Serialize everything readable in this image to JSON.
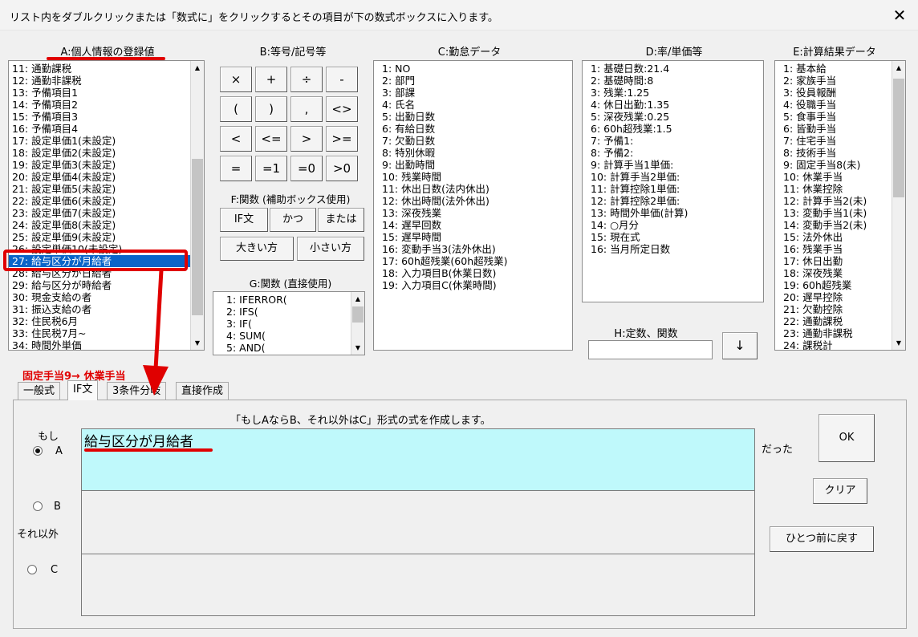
{
  "window": {
    "title": "リスト内をダブルクリックまたは「数式に」をクリックするとその項目が下の数式ボックスに入ります。",
    "close_glyph": "✕"
  },
  "panels": {
    "a": {
      "label": "A:個人情報の登録値",
      "items": [
        "11: 通勤課税",
        "12: 通勤非課税",
        "13: 予備項目1",
        "14: 予備項目2",
        "15: 予備項目3",
        "16: 予備項目4",
        "17: 設定単価1(未設定)",
        "18: 設定単価2(未設定)",
        "19: 設定単価3(未設定)",
        "20: 設定単価4(未設定)",
        "21: 設定単価5(未設定)",
        "22: 設定単価6(未設定)",
        "23: 設定単価7(未設定)",
        "24: 設定単価8(未設定)",
        "25: 設定単価9(未設定)",
        "26: 設定単価10(未設定)",
        "27: 給与区分が月給者",
        "28: 給与区分が日給者",
        "29: 給与区分が時給者",
        "30: 現金支給の者",
        "31: 振込支給の者",
        "32: 住民税6月",
        "33: 住民税7月~",
        "34: 時間外単価"
      ],
      "selected_index": 16
    },
    "b": {
      "label": "B:等号/記号等",
      "buttons": [
        "×",
        "+",
        "÷",
        "-",
        "(",
        ")",
        ",",
        "<>",
        "<",
        "<=",
        ">",
        ">=",
        "=",
        "=1",
        "=0",
        ">0"
      ]
    },
    "f": {
      "label": "F:関数 (補助ボックス使用)",
      "buttons": [
        "IF文",
        "かつ",
        "または",
        "大きい方",
        "小さい方"
      ]
    },
    "g": {
      "label": "G:関数 (直接使用)",
      "items": [
        "1: IFERROR(",
        "2: IFS(",
        "3: IF(",
        "4: SUM(",
        "5: AND("
      ]
    },
    "c": {
      "label": "C:勤怠データ",
      "items": [
        "1: NO",
        "2: 部門",
        "3: 部課",
        "4: 氏名",
        "5: 出勤日数",
        "6: 有給日数",
        "7: 欠勤日数",
        "8: 特別休暇",
        "9: 出勤時間",
        "10: 残業時間",
        "11: 休出日数(法内休出)",
        "12: 休出時間(法外休出)",
        "13: 深夜残業",
        "14: 遅早回数",
        "15: 遅早時間",
        "16: 変動手当3(法外休出)",
        "17: 60h超残業(60h超残業)",
        "18: 入力項目B(休業日数)",
        "19: 入力項目C(休業時間)"
      ]
    },
    "d": {
      "label": "D:率/単価等",
      "items": [
        "1: 基礎日数:21.4",
        "2: 基礎時間:8",
        "3: 残業:1.25",
        "4: 休日出勤:1.35",
        "5: 深夜残業:0.25",
        "6: 60h超残業:1.5",
        "7: 予備1:",
        "8: 予備2:",
        "9: 計算手当1単価:",
        "10: 計算手当2単価:",
        "11: 計算控除1単価:",
        "12: 計算控除2単価:",
        "13: 時間外単価(計算)",
        "14: ○月分",
        "15: 現在式",
        "16: 当月所定日数"
      ]
    },
    "h": {
      "label": "H:定数、関数",
      "input_value": "",
      "down_button": "↓"
    },
    "e": {
      "label": "E:計算結果データ",
      "items": [
        "1: 基本給",
        "2: 家族手当",
        "3: 役員報酬",
        "4: 役職手当",
        "5: 食事手当",
        "6: 皆勤手当",
        "7: 住宅手当",
        "8: 技術手当",
        "9: 固定手当8(未)",
        "10: 休業手当",
        "11: 休業控除",
        "12: 計算手当2(未)",
        "13: 変動手当1(未)",
        "14: 変動手当2(未)",
        "15: 法外休出",
        "16: 残業手当",
        "17: 休日出勤",
        "18: 深夜残業",
        "19: 60h超残業",
        "20: 遅早控除",
        "21: 欠勤控除",
        "22: 通勤課税",
        "23: 通勤非課税",
        "24: 課税計"
      ]
    }
  },
  "annotation": {
    "text": "固定手当9→ 休業手当",
    "color": "#e00000"
  },
  "tabs": [
    {
      "label": "一般式",
      "active": false
    },
    {
      "label": "IF文",
      "active": true
    },
    {
      "label": "3条件分岐",
      "active": false
    },
    {
      "label": "直接作成",
      "active": false
    }
  ],
  "if_form": {
    "description": "「もしAならB、それ以外はC」形式の式を作成します。",
    "moshi_label": "もし",
    "a_label": "A",
    "b_label": "B",
    "c_label": "C",
    "else_label": "それ以外",
    "datta_label": "だった",
    "a_value": "給与区分が月給者",
    "b_value": "",
    "c_value": "",
    "selected_radio": "A",
    "a_box_color": "#bff9fb"
  },
  "buttons": {
    "ok": "OK",
    "clear": "クリア",
    "undo": "ひとつ前に戻す"
  }
}
